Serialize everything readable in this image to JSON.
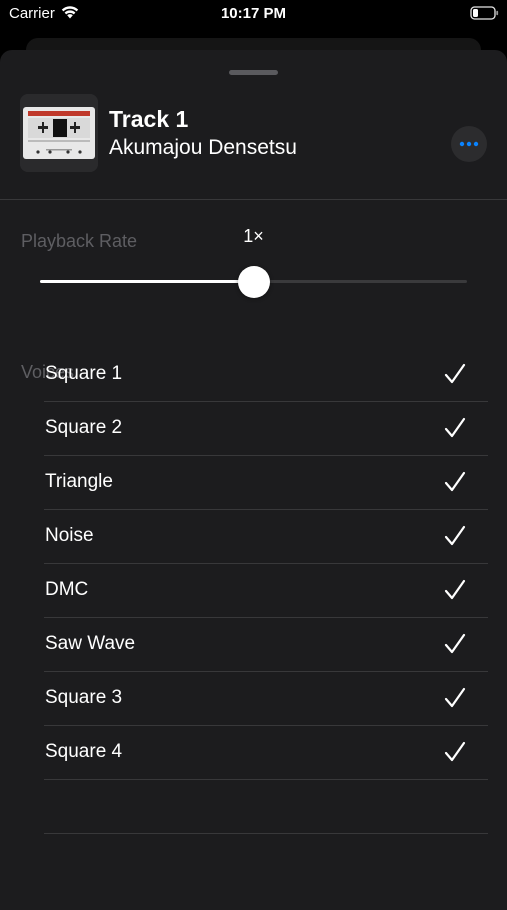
{
  "status_bar": {
    "carrier": "Carrier",
    "time": "10:17 PM"
  },
  "track": {
    "title": "Track 1",
    "subtitle": "Akumajou Densetsu",
    "artwork_icon": "cassette-tape-icon"
  },
  "more_button": {
    "icon": "ellipsis-icon",
    "color": "#0a84ff"
  },
  "playback": {
    "section_label": "Playback Rate",
    "rate_label": "1×",
    "slider_fraction": 0.5
  },
  "voices": {
    "section_label": "Voices",
    "items": [
      {
        "label": "Square 1",
        "checked": true
      },
      {
        "label": "Square 2",
        "checked": true
      },
      {
        "label": "Triangle",
        "checked": true
      },
      {
        "label": "Noise",
        "checked": true
      },
      {
        "label": "DMC",
        "checked": true
      },
      {
        "label": "Saw Wave",
        "checked": true
      },
      {
        "label": "Square 3",
        "checked": true
      },
      {
        "label": "Square 4",
        "checked": true
      }
    ]
  },
  "colors": {
    "sheet_background": "#1c1c1e",
    "accent": "#0a84ff",
    "section_label": "#5e5e62"
  }
}
